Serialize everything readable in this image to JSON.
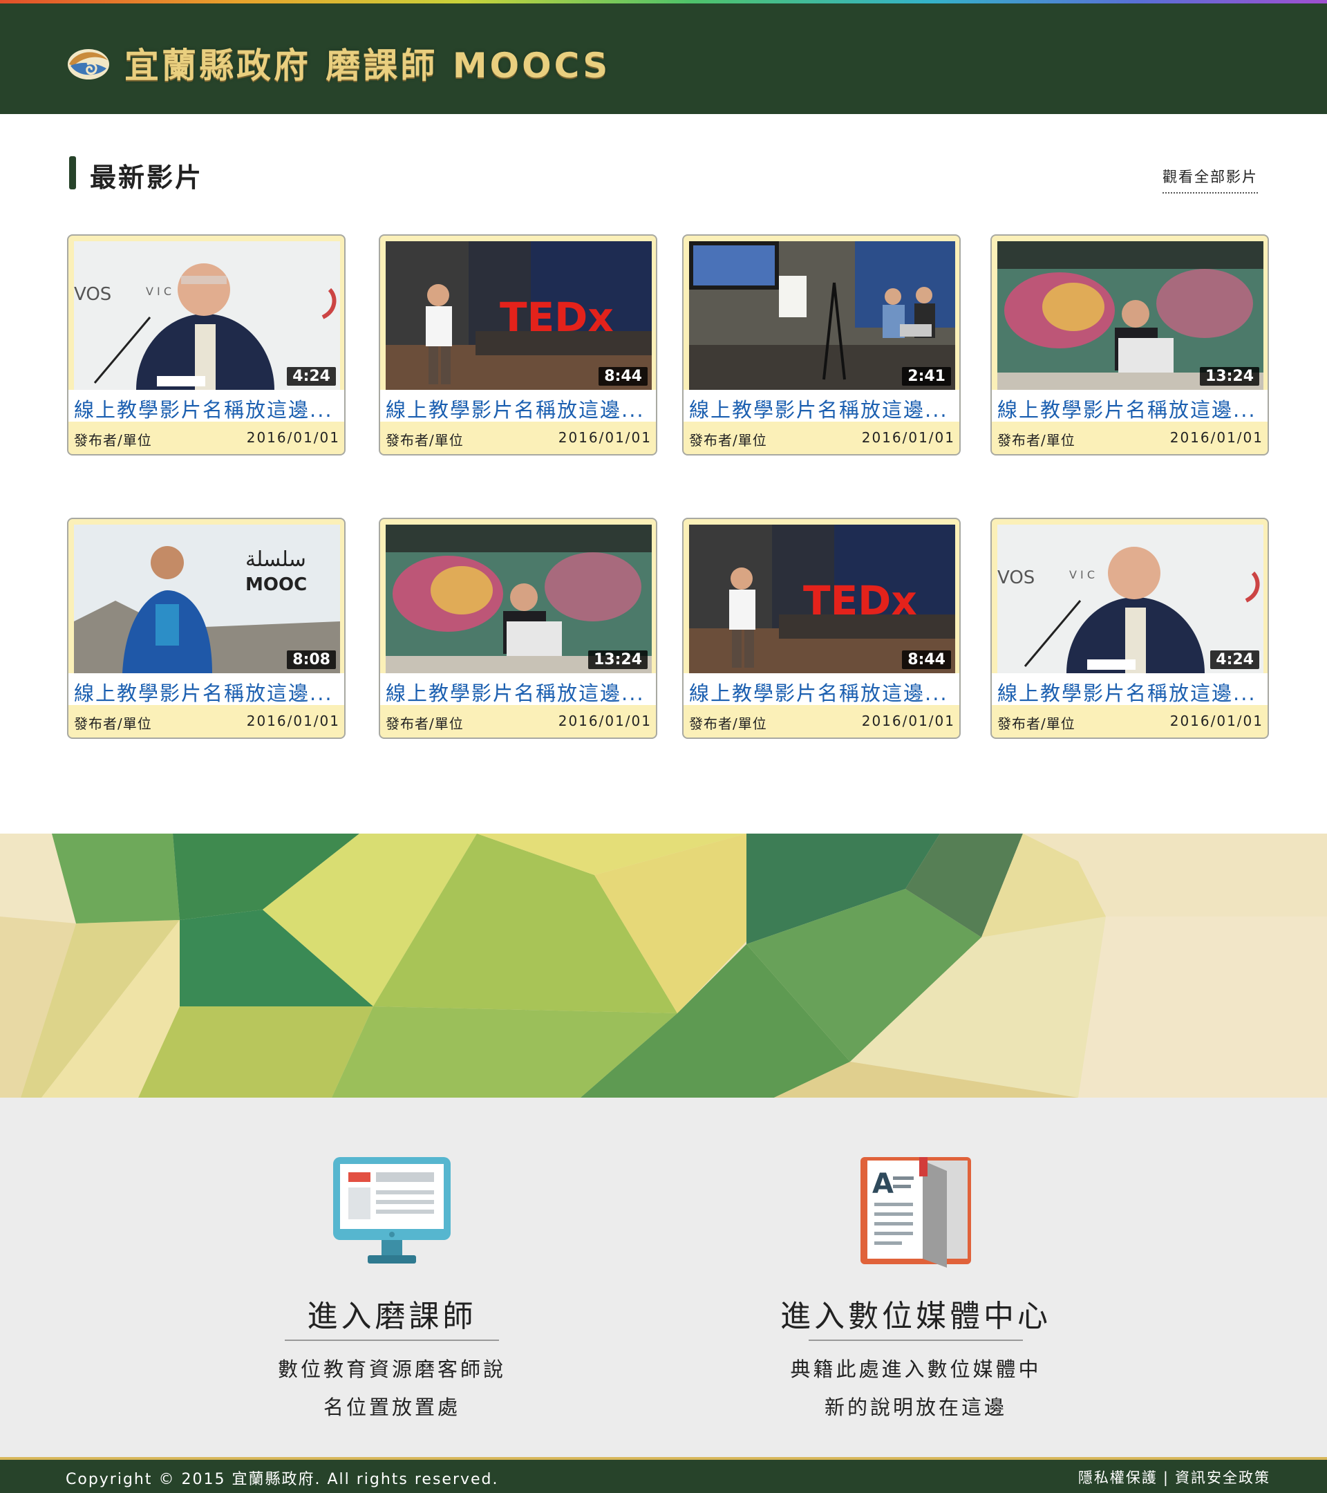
{
  "header": {
    "site_title": "宜蘭縣政府 磨課師 MOOCS"
  },
  "latest": {
    "title": "最新影片",
    "view_all": "觀看全部影片"
  },
  "videos": [
    {
      "title": "線上教學影片名稱放這邊...",
      "author": "發布者/單位",
      "date": "2016/01/01",
      "duration": "4:24",
      "thumb": "gates"
    },
    {
      "title": "線上教學影片名稱放這邊...",
      "author": "發布者/單位",
      "date": "2016/01/01",
      "duration": "8:44",
      "thumb": "tedx"
    },
    {
      "title": "線上教學影片名稱放這邊...",
      "author": "發布者/單位",
      "date": "2016/01/01",
      "duration": "2:41",
      "thumb": "studio"
    },
    {
      "title": "線上教學影片名稱放這邊...",
      "author": "發布者/單位",
      "date": "2016/01/01",
      "duration": "13:24",
      "thumb": "graffiti"
    },
    {
      "title": "線上教學影片名稱放這邊...",
      "author": "發布者/單位",
      "date": "2016/01/01",
      "duration": "8:08",
      "thumb": "mooc"
    },
    {
      "title": "線上教學影片名稱放這邊...",
      "author": "發布者/單位",
      "date": "2016/01/01",
      "duration": "13:24",
      "thumb": "graffiti"
    },
    {
      "title": "線上教學影片名稱放這邊...",
      "author": "發布者/單位",
      "date": "2016/01/01",
      "duration": "8:44",
      "thumb": "tedx"
    },
    {
      "title": "線上教學影片名稱放這邊...",
      "author": "發布者/單位",
      "date": "2016/01/01",
      "duration": "4:24",
      "thumb": "gates"
    }
  ],
  "features": [
    {
      "title": "進入磨課師",
      "desc_line1": "數位教育資源磨客師說",
      "desc_line2": "名位置放置處",
      "icon": "monitor-icon"
    },
    {
      "title": "進入數位媒體中心",
      "desc_line1": "典籍此處進入數位媒體中",
      "desc_line2": "新的說明放在這邊",
      "icon": "book-icon"
    }
  ],
  "footer": {
    "copyright": "Copyright © 2015 宜蘭縣政府. All rights reserved.",
    "privacy": "隱私權保護",
    "separator": "|",
    "security": "資訊安全政策"
  },
  "colors": {
    "header_bg": "#27432a",
    "title_gold": "#e9cf7f",
    "card_meta_bg": "#fbf0b8",
    "link_blue": "#1b5fb0",
    "footer_border": "#d7b75a"
  }
}
